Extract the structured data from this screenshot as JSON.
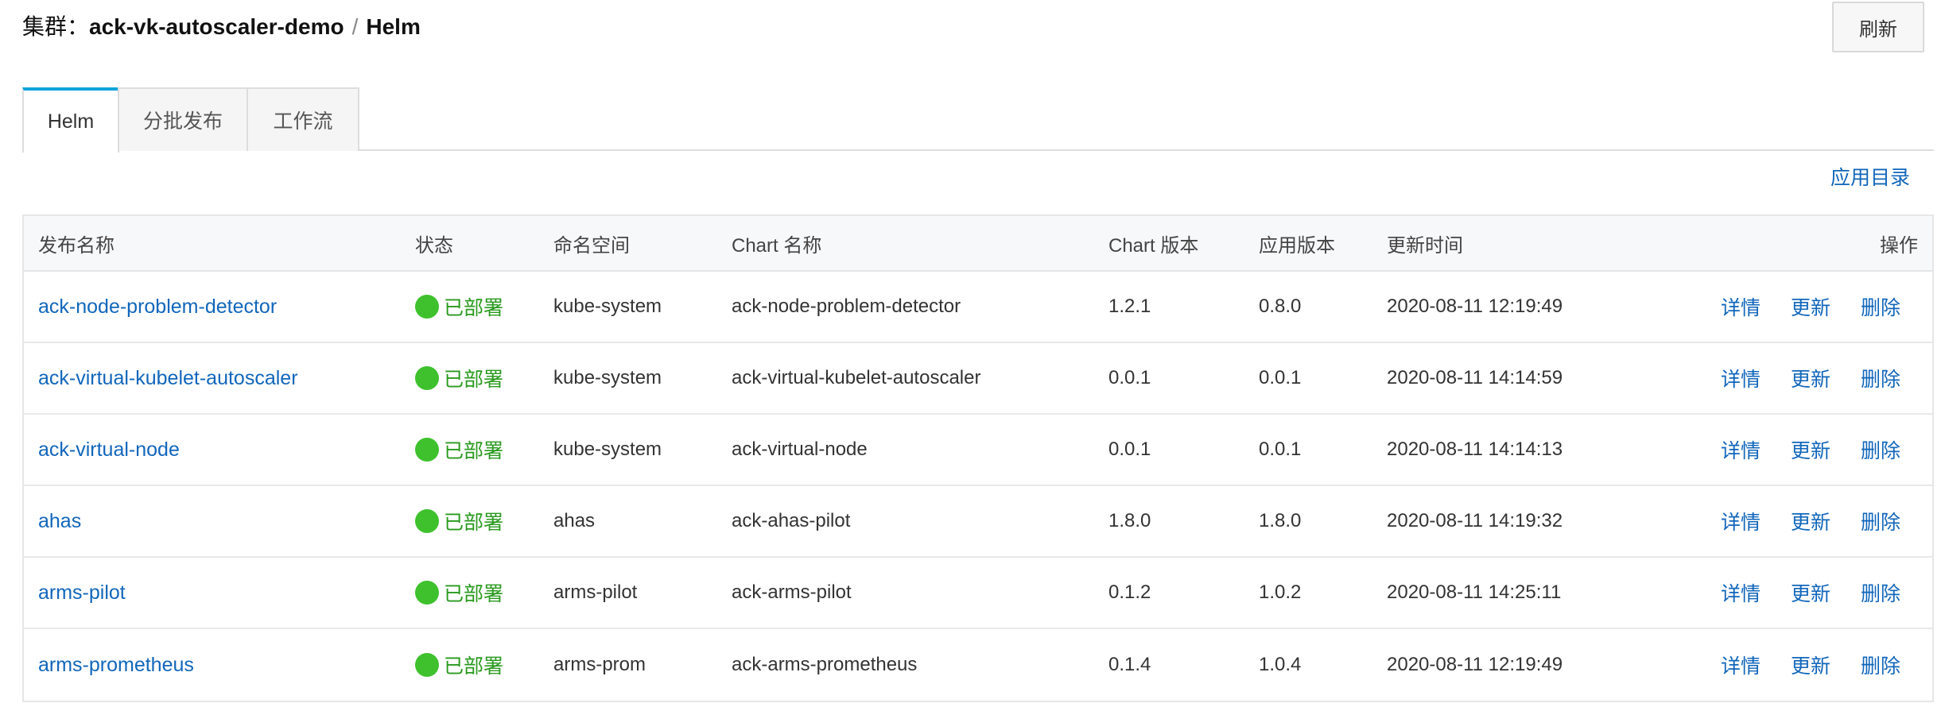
{
  "header": {
    "prefix": "集群：",
    "cluster_name": "ack-vk-autoscaler-demo",
    "separator": "/",
    "section": "Helm",
    "refresh_label": "刷新"
  },
  "tabs": [
    {
      "label": "Helm",
      "active": true
    },
    {
      "label": "分批发布",
      "active": false
    },
    {
      "label": "工作流",
      "active": false
    }
  ],
  "app_catalog_label": "应用目录",
  "table": {
    "columns": {
      "name": "发布名称",
      "status": "状态",
      "namespace": "命名空间",
      "chart_name": "Chart 名称",
      "chart_version": "Chart 版本",
      "app_version": "应用版本",
      "updated": "更新时间",
      "actions": "操作"
    },
    "action_labels": {
      "detail": "详情",
      "update": "更新",
      "delete": "删除"
    },
    "status_color": "#3ec12d",
    "rows": [
      {
        "name": "ack-node-problem-detector",
        "status": "已部署",
        "namespace": "kube-system",
        "chart_name": "ack-node-problem-detector",
        "chart_version": "1.2.1",
        "app_version": "0.8.0",
        "updated": "2020-08-11 12:19:49"
      },
      {
        "name": "ack-virtual-kubelet-autoscaler",
        "status": "已部署",
        "namespace": "kube-system",
        "chart_name": "ack-virtual-kubelet-autoscaler",
        "chart_version": "0.0.1",
        "app_version": "0.0.1",
        "updated": "2020-08-11 14:14:59"
      },
      {
        "name": "ack-virtual-node",
        "status": "已部署",
        "namespace": "kube-system",
        "chart_name": "ack-virtual-node",
        "chart_version": "0.0.1",
        "app_version": "0.0.1",
        "updated": "2020-08-11 14:14:13"
      },
      {
        "name": "ahas",
        "status": "已部署",
        "namespace": "ahas",
        "chart_name": "ack-ahas-pilot",
        "chart_version": "1.8.0",
        "app_version": "1.8.0",
        "updated": "2020-08-11 14:19:32"
      },
      {
        "name": "arms-pilot",
        "status": "已部署",
        "namespace": "arms-pilot",
        "chart_name": "ack-arms-pilot",
        "chart_version": "0.1.2",
        "app_version": "1.0.2",
        "updated": "2020-08-11 14:25:11"
      },
      {
        "name": "arms-prometheus",
        "status": "已部署",
        "namespace": "arms-prom",
        "chart_name": "ack-arms-prometheus",
        "chart_version": "0.1.4",
        "app_version": "1.0.4",
        "updated": "2020-08-11 12:19:49"
      }
    ]
  }
}
